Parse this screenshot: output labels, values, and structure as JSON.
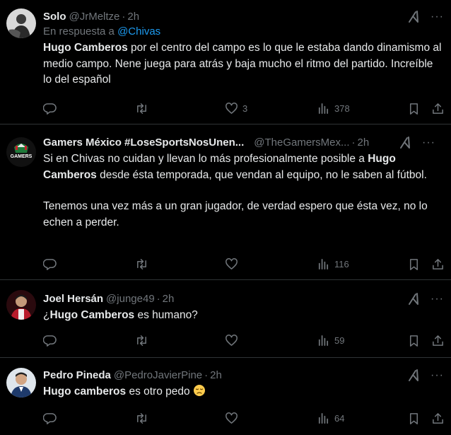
{
  "tweets": [
    {
      "name": "Solo",
      "handle": "@JrMeltze",
      "time": "2h",
      "reply_prefix": "En respuesta a",
      "reply_mention": "@Chivas",
      "text_bold": "Hugo Camberos",
      "text_rest": " por el centro del campo es lo que le estaba dando dinamismo al medio campo. Nene juega para atrás y baja mucho el ritmo del partido. Increíble lo del español",
      "likes": "3",
      "views": "378"
    },
    {
      "name": "Gamers México #LoseSportsNosUnen...",
      "handle": "@TheGamersMex...",
      "time": "2h",
      "avatar_text": "GAMERS",
      "text_pre": "Si en Chivas no cuidan y llevan lo más profesionalmente posible a ",
      "text_bold": "Hugo Camberos",
      "text_post": " desde ésta temporada, que vendan al equipo, no le saben al fútbol.",
      "text_para2": "Tenemos una vez más a un gran jugador, de verdad espero que ésta vez, no lo echen a perder.",
      "views": "116"
    },
    {
      "name": "Joel Hersán",
      "handle": "@junge49",
      "time": "2h",
      "text_pre": "¿",
      "text_bold": "Hugo Camberos",
      "text_post": " es humano?",
      "views": "59"
    },
    {
      "name": "Pedro Pineda",
      "handle": "@PedroJavierPine",
      "time": "2h",
      "text_bold": "Hugo camberos",
      "text_post": " es otro pedo",
      "views": "64"
    }
  ],
  "separator": "·",
  "more_label": "···",
  "colors": {
    "background": "#000000",
    "text": "#e7e9ea",
    "muted": "#71767b",
    "link": "#1d9bf0",
    "border": "#2f3336"
  },
  "icons": [
    "reply-icon",
    "retweet-icon",
    "like-icon",
    "views-icon",
    "bookmark-icon",
    "share-icon",
    "grok-icon",
    "more-icon",
    "emoji-icon"
  ]
}
